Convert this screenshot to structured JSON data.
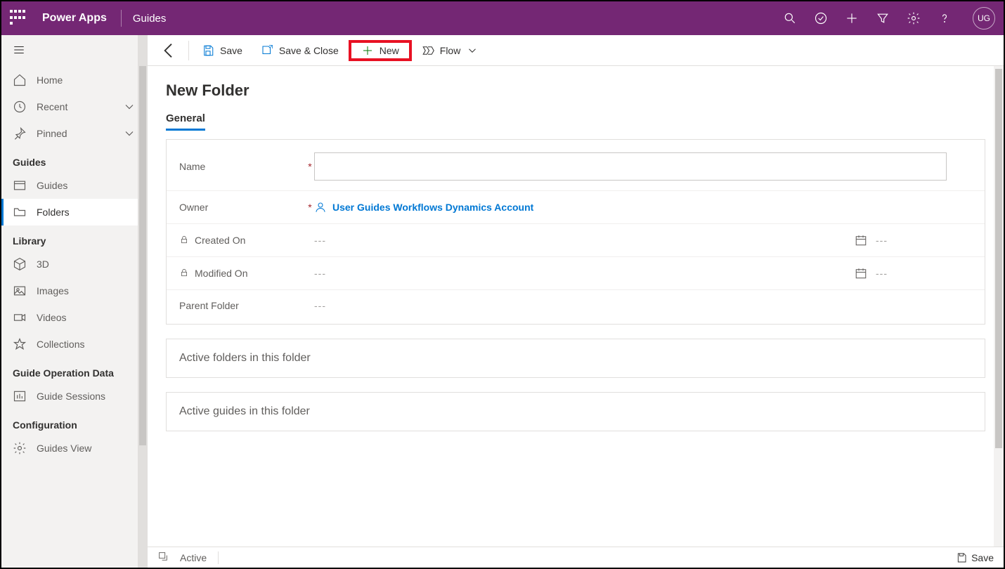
{
  "header": {
    "app_name": "Power Apps",
    "env_name": "Guides",
    "avatar_initials": "UG"
  },
  "sidebar": {
    "top": [
      {
        "label": "Home",
        "icon": "home"
      },
      {
        "label": "Recent",
        "icon": "clock",
        "chev": true
      },
      {
        "label": "Pinned",
        "icon": "pin",
        "chev": true
      }
    ],
    "sections": [
      {
        "title": "Guides",
        "items": [
          {
            "label": "Guides",
            "icon": "window"
          },
          {
            "label": "Folders",
            "icon": "folder",
            "active": true
          }
        ]
      },
      {
        "title": "Library",
        "items": [
          {
            "label": "3D",
            "icon": "cube"
          },
          {
            "label": "Images",
            "icon": "image"
          },
          {
            "label": "Videos",
            "icon": "video"
          },
          {
            "label": "Collections",
            "icon": "star"
          }
        ]
      },
      {
        "title": "Guide Operation Data",
        "items": [
          {
            "label": "Guide Sessions",
            "icon": "chart"
          }
        ]
      },
      {
        "title": "Configuration",
        "items": [
          {
            "label": "Guides View",
            "icon": "gear"
          }
        ]
      }
    ]
  },
  "commandbar": {
    "save": "Save",
    "save_close": "Save & Close",
    "new": "New",
    "flow": "Flow"
  },
  "page": {
    "title": "New Folder",
    "tab_general": "General",
    "fields": {
      "name_label": "Name",
      "owner_label": "Owner",
      "owner_value": "User Guides Workflows Dynamics Account",
      "created_label": "Created On",
      "modified_label": "Modified On",
      "parent_label": "Parent Folder",
      "empty": "---"
    },
    "subgrids": {
      "folders_title": "Active folders in this folder",
      "guides_title": "Active guides in this folder"
    }
  },
  "statusbar": {
    "state": "Active",
    "save": "Save"
  }
}
